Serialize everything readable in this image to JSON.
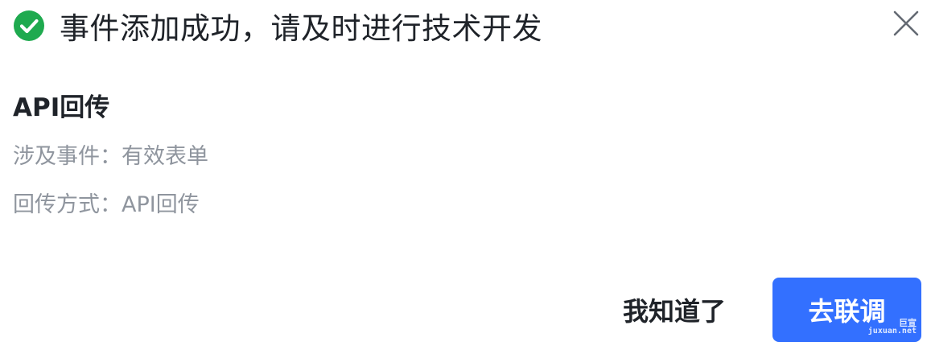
{
  "dialog": {
    "title": "事件添加成功，请及时进行技术开发",
    "icon": "check-circle-icon",
    "close_icon": "close-icon"
  },
  "section": {
    "title": "API回传",
    "rows": [
      {
        "label": "涉及事件：",
        "value": "有效表单"
      },
      {
        "label": "回传方式：",
        "value": "API回传"
      }
    ]
  },
  "footer": {
    "secondary_label": "我知道了",
    "primary_label": "去联调"
  },
  "watermark": {
    "top": "巨宣",
    "bottom": "juxuan.net"
  },
  "colors": {
    "success": "#1faa4f",
    "primary": "#3370ff",
    "text": "#1f2329",
    "muted": "#8f959e"
  }
}
